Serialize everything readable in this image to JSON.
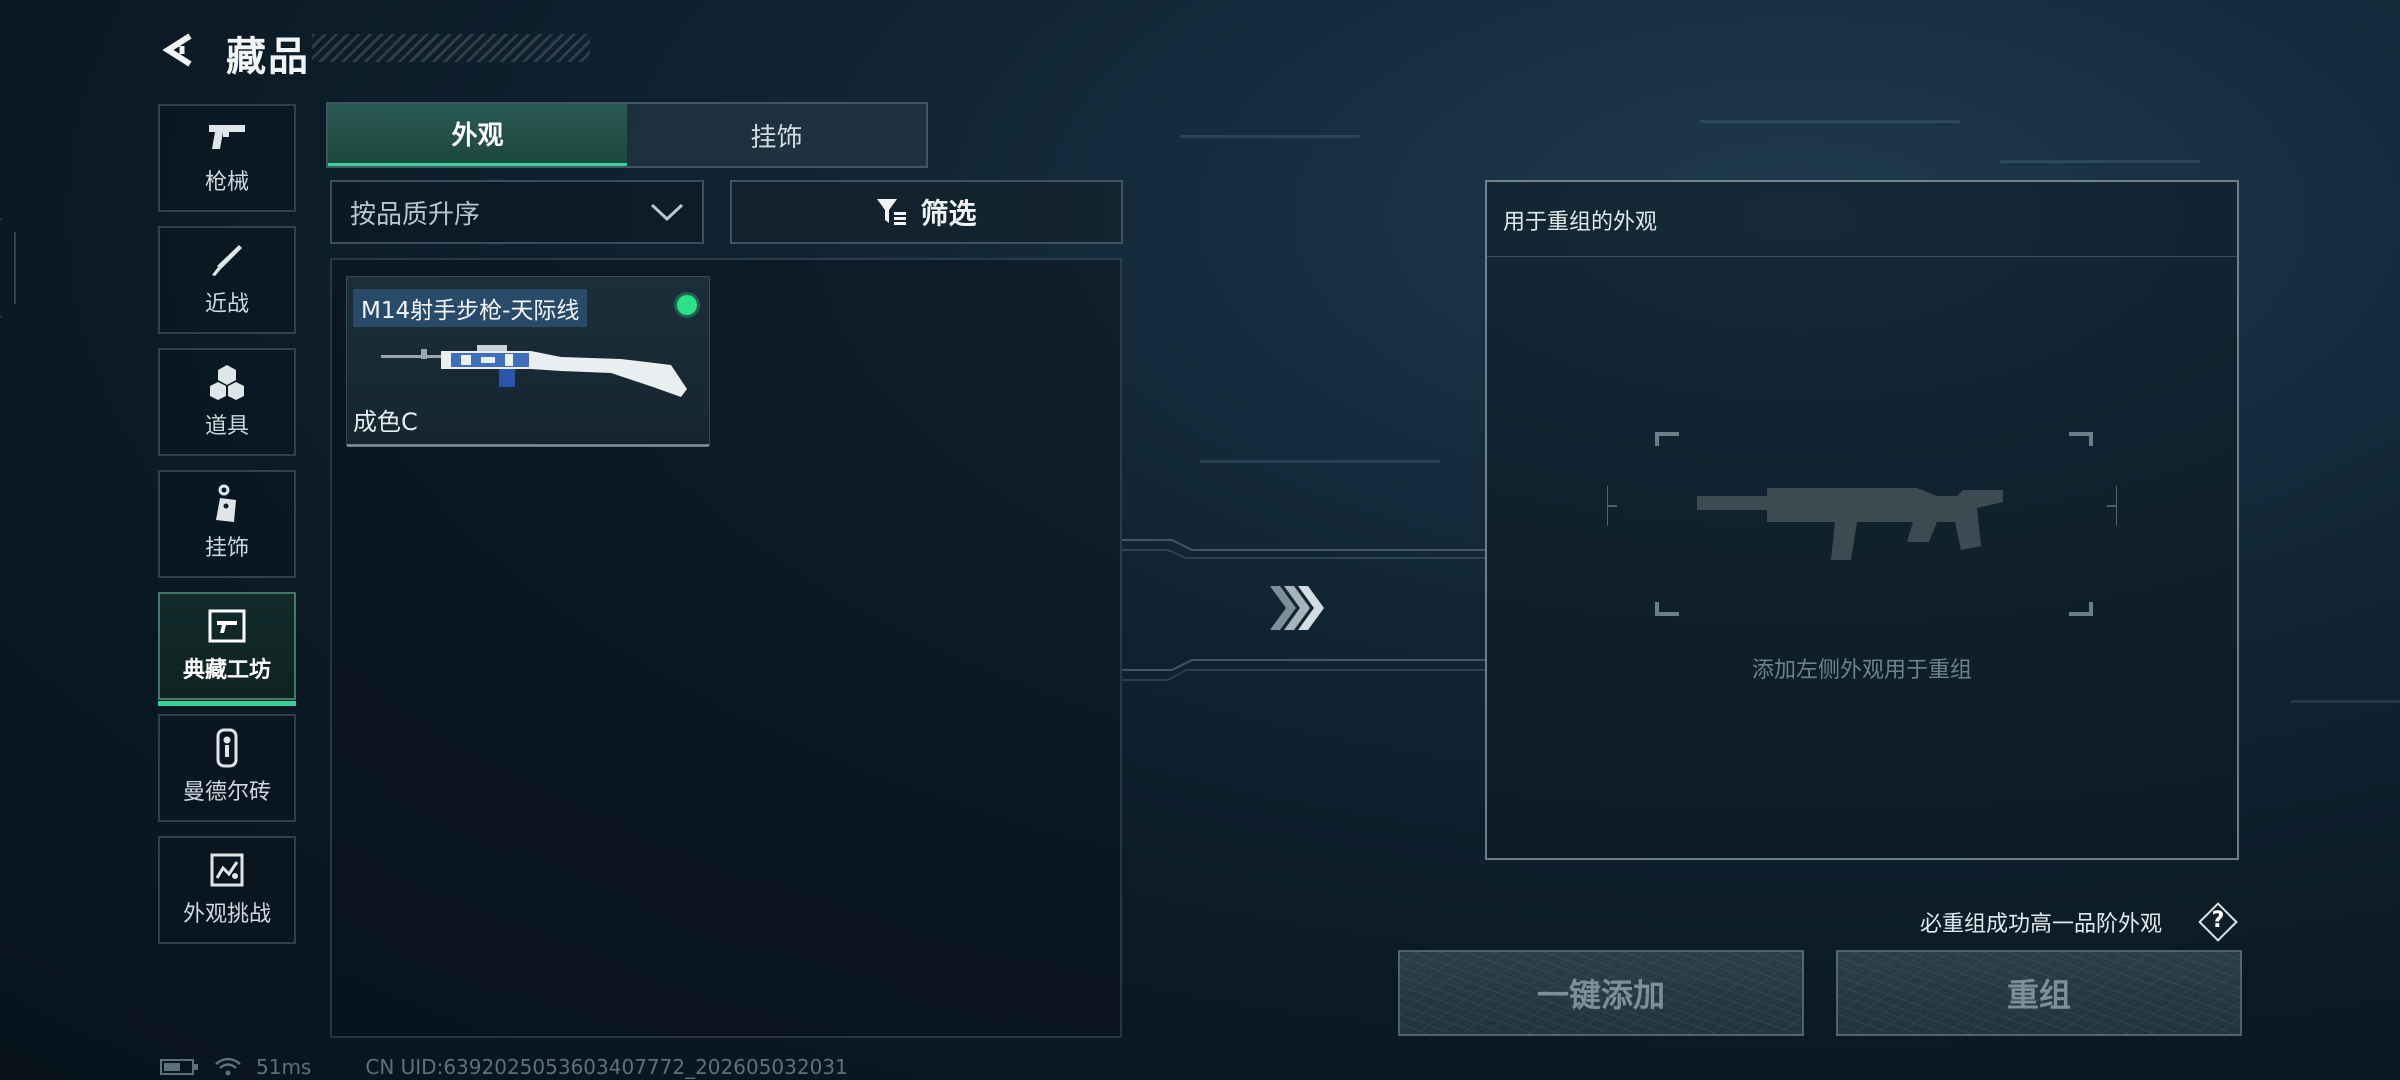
{
  "header": {
    "title": "藏品",
    "back_icon": "back-arrow-icon"
  },
  "sidebar": {
    "items": [
      {
        "label": "枪械",
        "icon": "pistol-icon",
        "active": false
      },
      {
        "label": "近战",
        "icon": "knife-icon",
        "active": false
      },
      {
        "label": "道具",
        "icon": "cubes-icon",
        "active": false
      },
      {
        "label": "挂饰",
        "icon": "charm-tag-icon",
        "active": false
      },
      {
        "label": "典藏工坊",
        "icon": "workshop-gun-icon",
        "active": true
      },
      {
        "label": "曼德尔砖",
        "icon": "brick-key-icon",
        "active": false
      },
      {
        "label": "外观挑战",
        "icon": "challenge-map-icon",
        "active": false
      }
    ]
  },
  "tabs": [
    {
      "label": "外观",
      "active": true
    },
    {
      "label": "挂饰",
      "active": false
    }
  ],
  "sort": {
    "value": "按品质升序"
  },
  "filter": {
    "label": "筛选"
  },
  "items": [
    {
      "name": "M14射手步枪-天际线",
      "grade": "成色C",
      "selected_indicator": true,
      "indicator_color": "#2fe08a"
    }
  ],
  "recombine": {
    "title": "用于重组的外观",
    "hint": "添加左侧外观用于重组",
    "guarantee": "必重组成功高一品阶外观",
    "help": "?",
    "add_all": "一键添加",
    "recombine_btn": "重组"
  },
  "status": {
    "ping": "51ms",
    "uid": "CN UID:6392025053603407772_202605032031"
  },
  "colors": {
    "accent": "#36d29a",
    "indicator": "#2fe08a",
    "tag_bg": "#2a4a6a"
  }
}
